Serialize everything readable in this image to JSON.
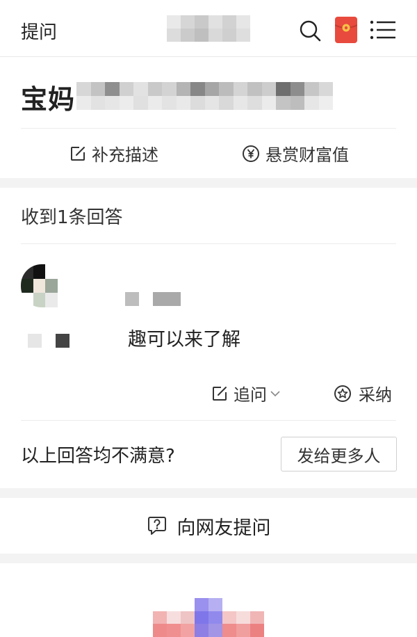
{
  "topbar": {
    "title": "提问",
    "icons": [
      "search-icon",
      "red-packet-icon",
      "menu-icon"
    ]
  },
  "question": {
    "text_visible": "宝妈",
    "supplement_label": "补充描述",
    "reward_label": "悬赏财富值"
  },
  "answers": {
    "heading": "收到1条回答",
    "answer_text_visible": "趣可以来了解",
    "followup_label": "追问",
    "accept_label": "采纳"
  },
  "unsatisfied": {
    "text": "以上回答均不满意?",
    "button_label": "发给更多人"
  },
  "ask": {
    "label": "向网友提问"
  },
  "colors": {
    "accent_red": "#e84a3d",
    "separator_gray": "#f3f3f3",
    "text": "#222222"
  }
}
